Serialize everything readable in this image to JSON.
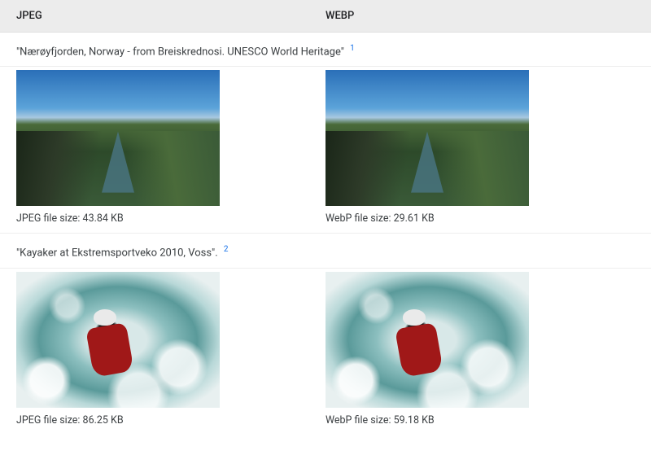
{
  "headers": {
    "jpeg": "JPEG",
    "webp": "WEBP"
  },
  "rows": [
    {
      "caption": "\"Nærøyfjorden, Norway - from Breiskrednosi. UNESCO World Heritage\"",
      "footnote": "1",
      "jpeg_size": "JPEG file size: 43.84 KB",
      "webp_size": "WebP file size: 29.61 KB"
    },
    {
      "caption": "\"Kayaker at Ekstremsportveko 2010, Voss\".",
      "footnote": "2",
      "jpeg_size": "JPEG file size: 86.25 KB",
      "webp_size": "WebP file size: 59.18 KB"
    }
  ]
}
